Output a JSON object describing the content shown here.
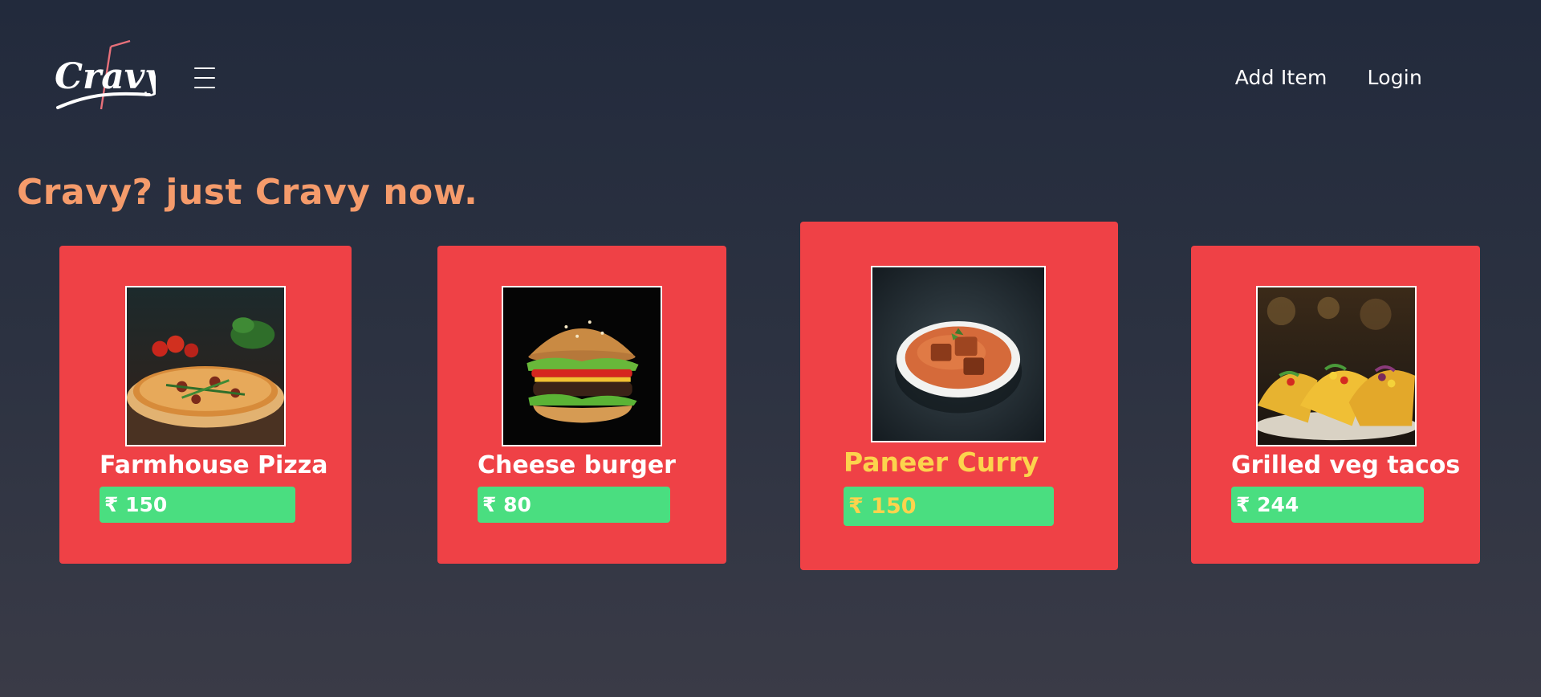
{
  "header": {
    "logo_text": "Cravy",
    "nav": {
      "add_item": "Add Item",
      "login": "Login"
    }
  },
  "hero": {
    "tagline": "Cravy? just Cravy now."
  },
  "items": [
    {
      "name": "Farmhouse Pizza",
      "price": "₹ 150",
      "image": "pizza-image"
    },
    {
      "name": "Cheese burger",
      "price": "₹ 80",
      "image": "burger-image"
    },
    {
      "name": "Paneer Curry",
      "price": "₹ 150",
      "image": "curry-image"
    },
    {
      "name": "Grilled veg tacos",
      "price": "₹ 244",
      "image": "tacos-image"
    }
  ],
  "colors": {
    "background_top": "#222a3c",
    "background_bottom": "#3a3b47",
    "card": "#ef4146",
    "price_badge": "#4ade80",
    "tagline": "#f59b6b",
    "hover_text": "#fcd34d"
  }
}
